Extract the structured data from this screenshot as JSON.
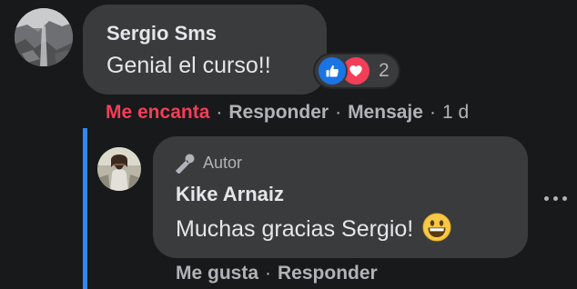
{
  "comments": [
    {
      "author": "Sergio Sms",
      "text": "Genial el curso!!",
      "reactions": {
        "icons": [
          "like-icon",
          "love-icon"
        ],
        "count": "2"
      },
      "actions": {
        "reaction": "Me encanta",
        "reply": "Responder",
        "message": "Mensaje",
        "time": "1 d"
      }
    }
  ],
  "replies": [
    {
      "badge": "Autor",
      "author": "Kike Arnaiz",
      "text": "Muchas gracias Sergio!",
      "emoji": "grinning-face-icon",
      "actions": {
        "like": "Me gusta",
        "reply": "Responder"
      }
    }
  ],
  "colors": {
    "background": "#18191a",
    "bubble": "#3a3b3c",
    "primary_text": "#e4e6eb",
    "secondary_text": "#b0b3b8",
    "love": "#f33e58",
    "like": "#1b74e4",
    "thread_line": "#2d88ff"
  }
}
